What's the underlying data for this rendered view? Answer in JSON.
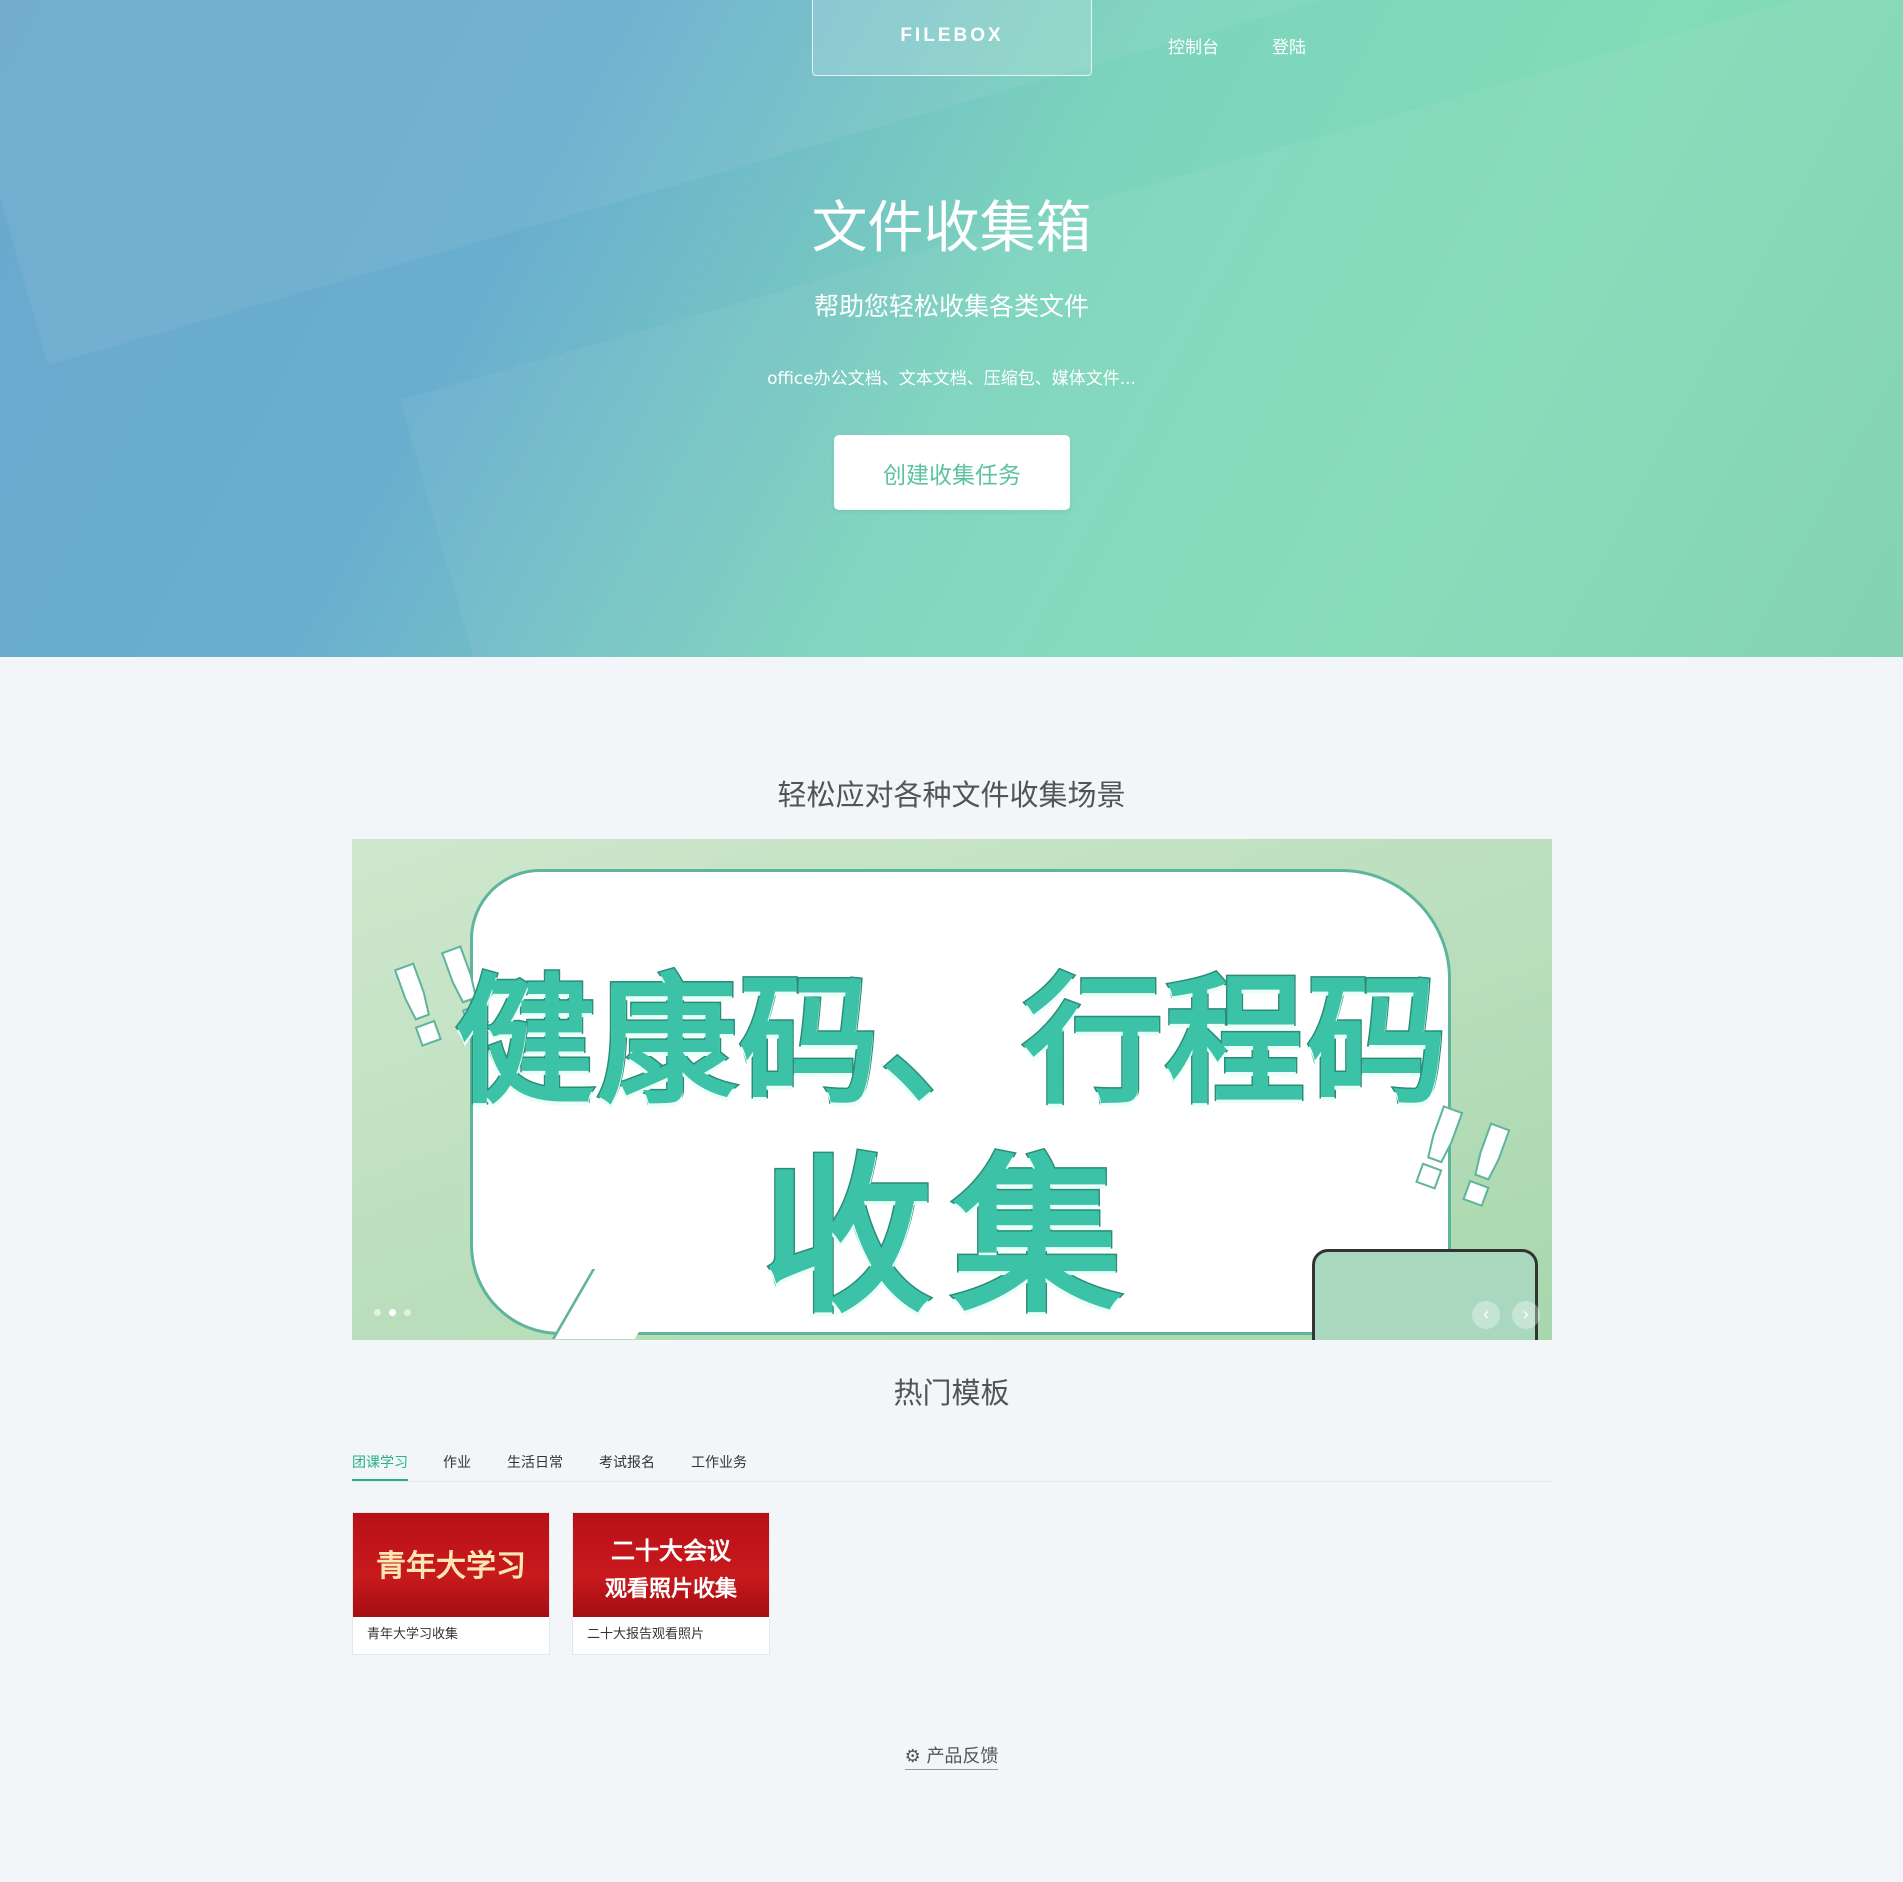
{
  "header": {
    "logo": "FILEBOX",
    "nav": [
      "控制台",
      "登陆"
    ]
  },
  "hero": {
    "title": "文件收集箱",
    "subtitle": "帮助您轻松收集各类文件",
    "description": "office办公文档、文本文档、压缩包、媒体文件...",
    "cta_label": "创建收集任务"
  },
  "scenes": {
    "title": "轻松应对各种文件收集场景",
    "slide_line1": "健康码、行程码",
    "slide_line2": "收集",
    "slide_count": 3,
    "active_slide": 2,
    "prev_icon": "‹",
    "next_icon": "›"
  },
  "templates": {
    "title": "热门模板",
    "tabs": [
      "团课学习",
      "作业",
      "生活日常",
      "考试报名",
      "工作业务"
    ],
    "active_tab": 0,
    "cards": [
      {
        "thumb_text": "青年大学习",
        "label": "青年大学习收集"
      },
      {
        "thumb_text_1": "二十大会议",
        "thumb_text_2": "观看照片收集",
        "label": "二十大报告观看照片"
      }
    ]
  },
  "footer": {
    "feedback_icon": "⚙",
    "feedback_label": "产品反馈"
  },
  "colors": {
    "accent": "#27b089",
    "cta_text": "#5cc2a3",
    "page_bg": "#f2f6f8"
  }
}
